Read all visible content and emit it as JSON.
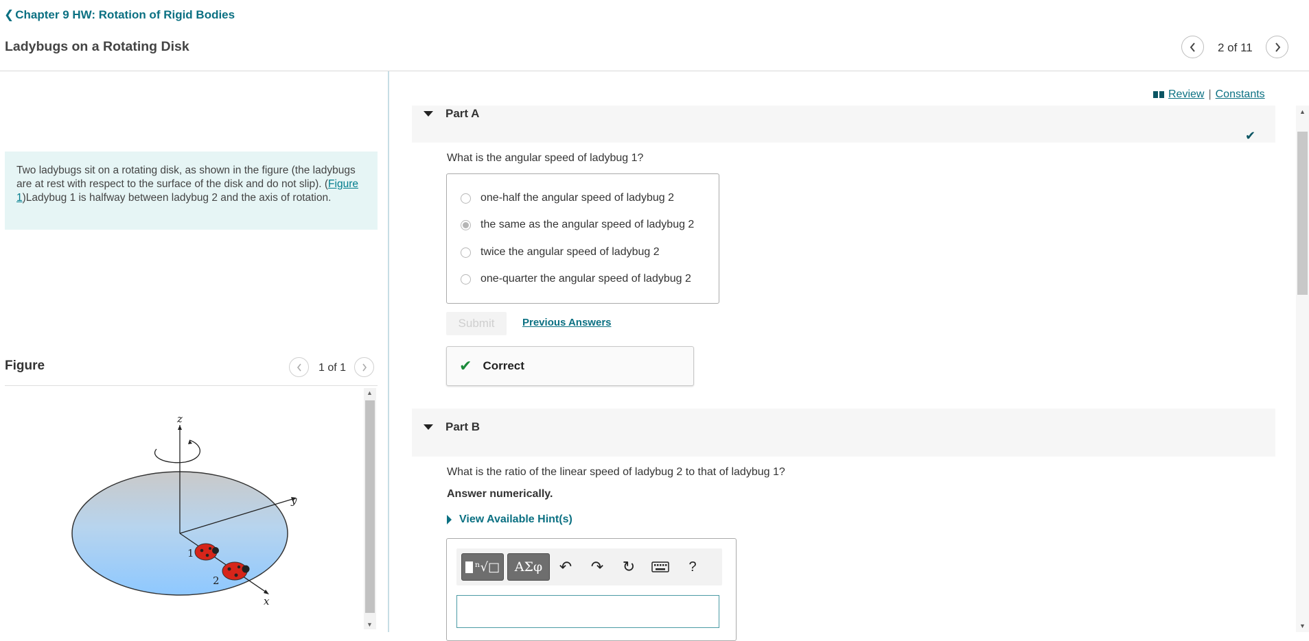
{
  "header": {
    "back_link": "Chapter 9 HW: Rotation of Rigid Bodies",
    "title": "Ladybugs on a Rotating Disk",
    "item_count": "2 of 11"
  },
  "intro": {
    "text_before": "Two ladybugs sit on a rotating disk, as shown in the figure (the ladybugs are at rest with respect to the surface of the disk and do not slip). (",
    "figure_link": "Figure 1",
    "text_after": ")Ladybug 1 is halfway between ladybug 2 and the axis of rotation."
  },
  "figure": {
    "heading": "Figure",
    "count": "1 of 1",
    "labels": {
      "z": "z",
      "y": "y",
      "x": "x",
      "bug1": "1",
      "bug2": "2"
    }
  },
  "links": {
    "review": "Review",
    "separator": "|",
    "constants": "Constants"
  },
  "partA": {
    "title": "Part A",
    "question": "What is the angular speed of ladybug 1?",
    "choices": [
      "one-half the angular speed of ladybug 2",
      "the same as the angular speed of ladybug 2",
      "twice the angular speed of ladybug 2",
      "one-quarter the angular speed of ladybug 2"
    ],
    "selected_index": 1,
    "submit_label": "Submit",
    "previous_answers": "Previous Answers",
    "result": "Correct"
  },
  "partB": {
    "title": "Part B",
    "question": "What is the ratio of the linear speed of ladybug 2 to that of ladybug 1?",
    "instruction": "Answer numerically.",
    "hints": "View Available Hint(s)",
    "toolbar": {
      "templates_glyph": "ⁿ√□",
      "greek_glyph": "ΑΣφ",
      "undo": "↶",
      "redo": "↷",
      "reset": "↻",
      "help": "?"
    },
    "answer_value": ""
  },
  "colors": {
    "link": "#0b7082",
    "intro_bg": "#e6f5f5",
    "correct_check": "#1b8a3a",
    "part_bar": "#f6f6f6"
  }
}
